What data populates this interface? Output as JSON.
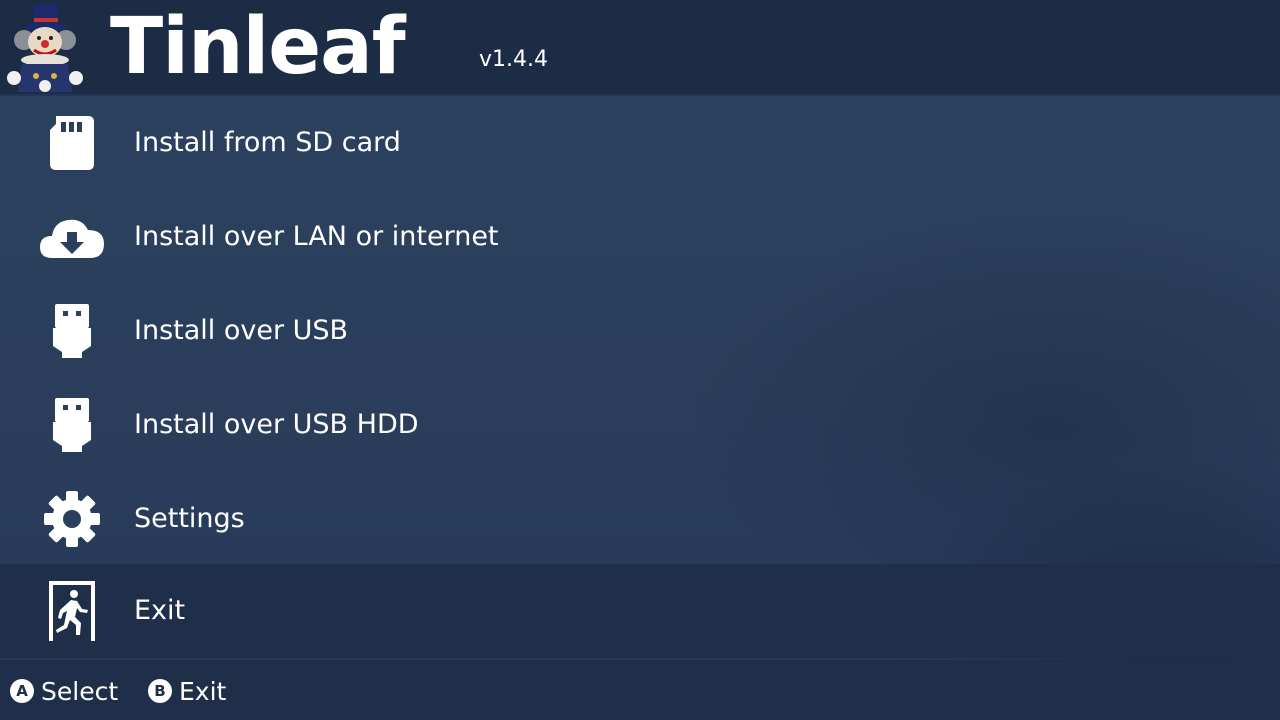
{
  "header": {
    "title": "Tinleaf",
    "version": "v1.4.4",
    "logo_icon": "clown-mascot-icon"
  },
  "menu": {
    "items": [
      {
        "label": "Install from SD card",
        "icon": "sd-card-icon"
      },
      {
        "label": "Install over LAN or internet",
        "icon": "cloud-download-icon"
      },
      {
        "label": "Install over USB",
        "icon": "usb-icon"
      },
      {
        "label": "Install over USB HDD",
        "icon": "usb-hdd-icon"
      },
      {
        "label": "Settings",
        "icon": "gear-icon"
      },
      {
        "label": "Exit",
        "icon": "exit-door-icon",
        "selected": true
      }
    ]
  },
  "footer": {
    "hints": [
      {
        "glyph": "A",
        "label": "Select"
      },
      {
        "glyph": "B",
        "label": "Exit"
      }
    ]
  },
  "colors": {
    "background": "#2b3f5c",
    "header": "#1d2c45",
    "selected_row": "#1f2f49",
    "footer": "#1f2f49",
    "text": "#ffffff"
  }
}
